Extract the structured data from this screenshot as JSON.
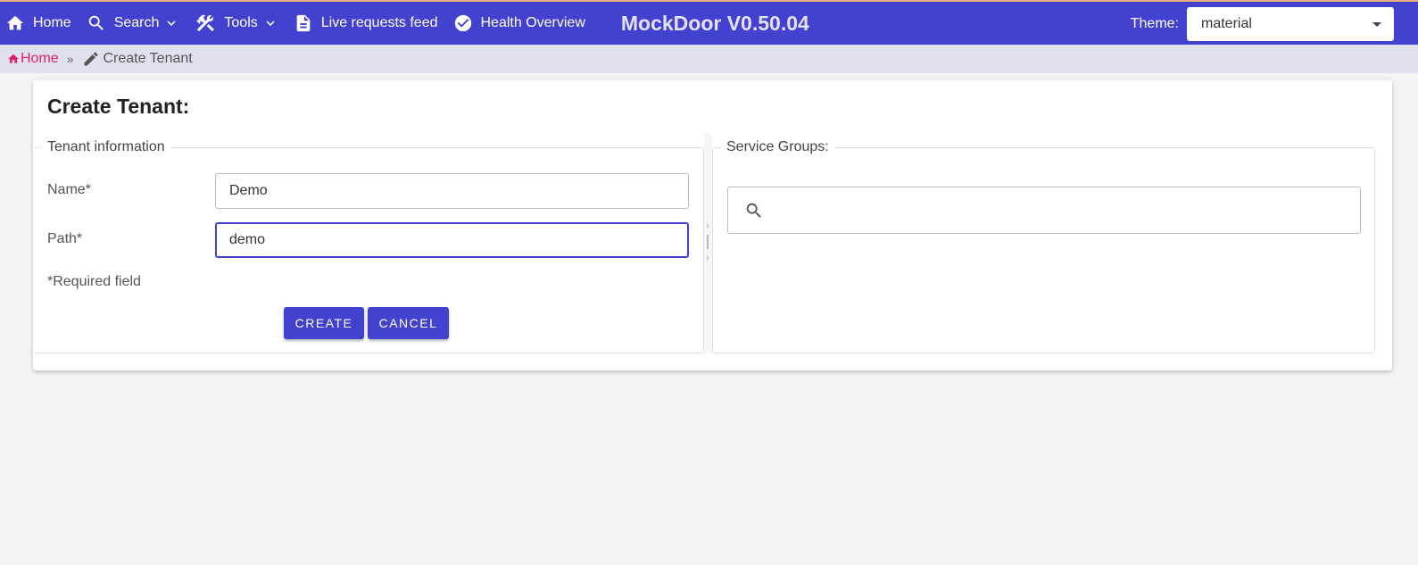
{
  "navbar": {
    "items": [
      {
        "label": "Home",
        "icon": "home-icon"
      },
      {
        "label": "Search",
        "icon": "search-icon",
        "dropdown": true
      },
      {
        "label": "Tools",
        "icon": "tools-icon",
        "dropdown": true
      },
      {
        "label": "Live requests feed",
        "icon": "document-icon"
      },
      {
        "label": "Health Overview",
        "icon": "check-circle-icon"
      }
    ],
    "brand": "MockDoor V0.50.04",
    "theme_label": "Theme:",
    "theme_value": "material",
    "colors": {
      "primary": "#4341cf",
      "accent_line": "#e8b080"
    }
  },
  "breadcrumb": {
    "home": "Home",
    "separator": "»",
    "current": "Create Tenant",
    "home_color": "#e0246c"
  },
  "form": {
    "title": "Create Tenant:",
    "tenant_info_legend": "Tenant information",
    "name_label": "Name*",
    "name_value": "Demo",
    "path_label": "Path*",
    "path_value": "demo",
    "required_note": "*Required field",
    "create_label": "CREATE",
    "cancel_label": "CANCEL"
  },
  "service_groups": {
    "legend": "Service Groups:",
    "search_value": ""
  }
}
